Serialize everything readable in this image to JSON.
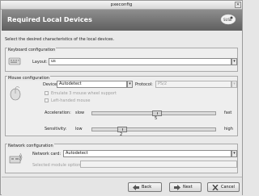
{
  "window": {
    "title": "pxeconfig",
    "close_glyph": "✕"
  },
  "header": {
    "title": "Required Local Devices",
    "logo_text": "SUSE"
  },
  "intro": "Select the desired characteristics of the local devices.",
  "keyboard": {
    "section_title": "Keyboard configuration",
    "layout_label": "Layout:",
    "layout_value": "us"
  },
  "mouse": {
    "section_title": "Mouse configuration",
    "device_label": "Device:",
    "device_value": "Autodetect",
    "protocol_label": "Protocol:",
    "protocol_value": "PS/2",
    "emulate_label": "Emulate 3 mouse wheel support",
    "left_handed_label": "Left-handed mouse",
    "acceleration_label": "Acceleration:",
    "acceleration_min": "slow",
    "acceleration_max": "fast",
    "acceleration_value": "5",
    "acceleration_fraction": 0.52,
    "sensitivity_label": "Sensitivity:",
    "sensitivity_min": "low",
    "sensitivity_max": "high",
    "sensitivity_value": "2",
    "sensitivity_fraction": 0.22
  },
  "network": {
    "section_title": "Network configuration",
    "card_label": "Network card:",
    "card_value": "Autodetect",
    "options_label": "Selected module options:",
    "options_value": ""
  },
  "buttons": {
    "back": "Back",
    "next": "Next",
    "cancel": "Cancel"
  },
  "colors": {
    "header_bg": "#6f6f6f",
    "window_bg": "#e9e9e9"
  }
}
